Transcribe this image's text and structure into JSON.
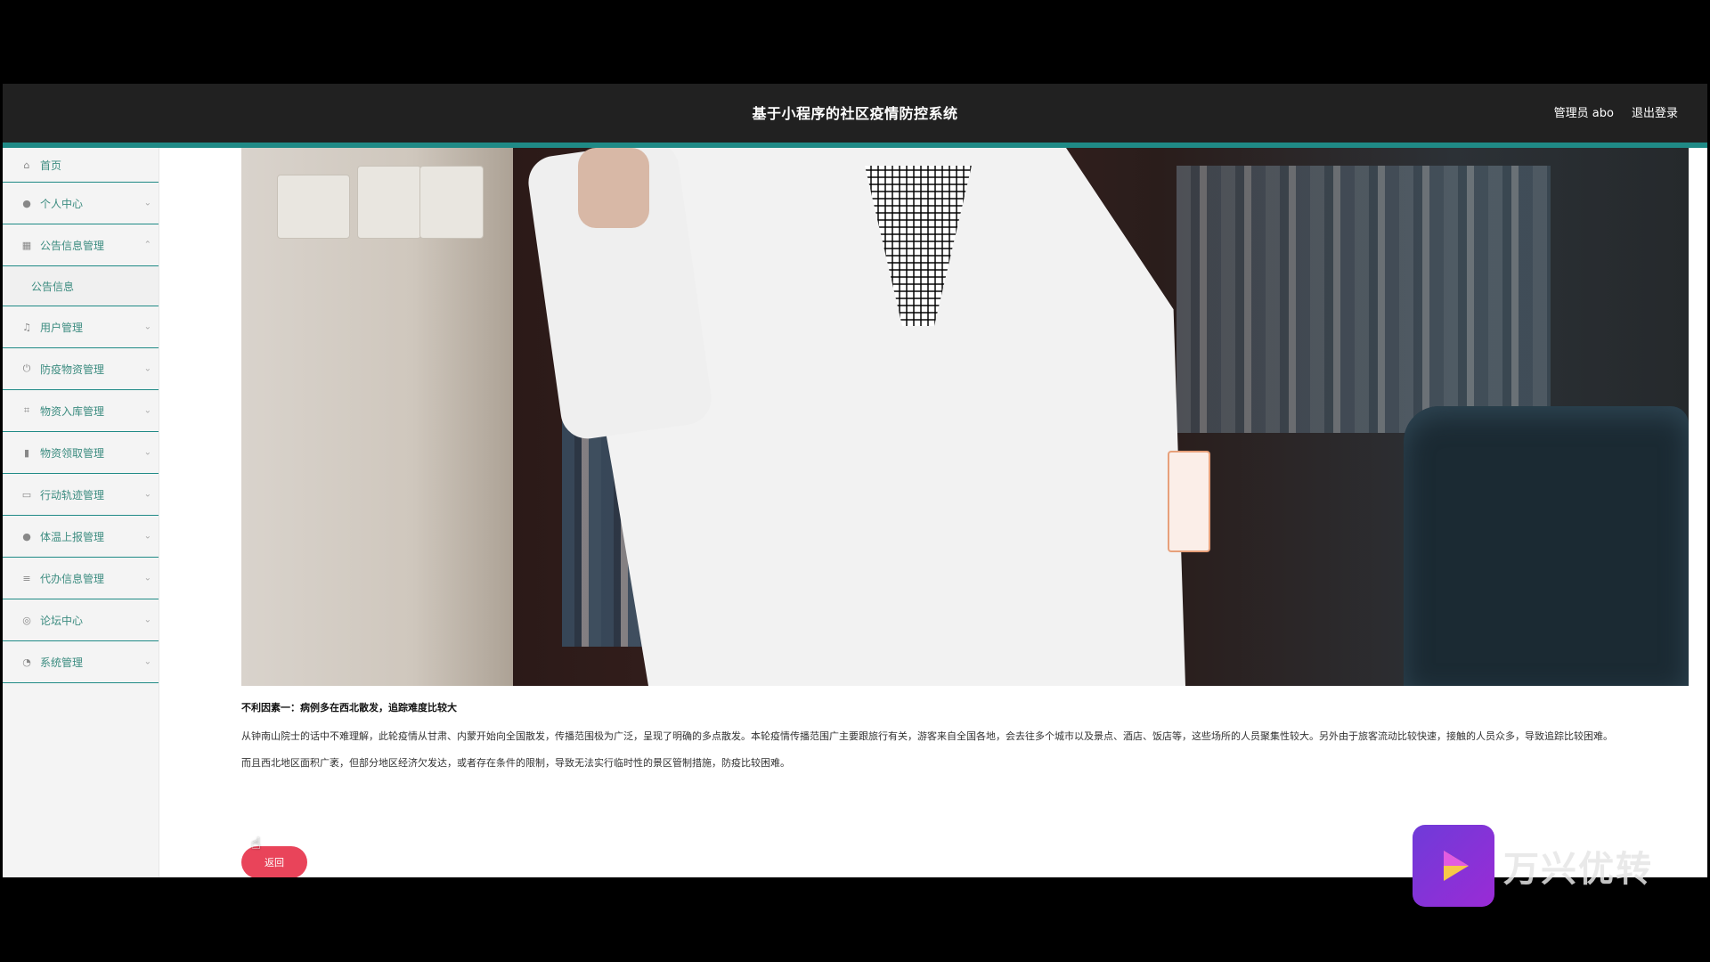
{
  "header": {
    "title": "基于小程序的社区疫情防控系统",
    "user_label": "管理员 abo",
    "logout_label": "退出登录"
  },
  "sidebar": {
    "items": [
      {
        "label": "首页",
        "icon": "home-icon"
      },
      {
        "label": "个人中心",
        "icon": "user-icon"
      },
      {
        "label": "公告信息管理",
        "icon": "notice-icon"
      },
      {
        "label": "用户管理",
        "icon": "mic-icon"
      },
      {
        "label": "防疫物资管理",
        "icon": "power-icon"
      },
      {
        "label": "物资入库管理",
        "icon": "crop-icon"
      },
      {
        "label": "物资领取管理",
        "icon": "bar-chart-icon"
      },
      {
        "label": "行动轨迹管理",
        "icon": "message-icon"
      },
      {
        "label": "体温上报管理",
        "icon": "user-icon"
      },
      {
        "label": "代办信息管理",
        "icon": "list-icon"
      },
      {
        "label": "论坛中心",
        "icon": "compass-icon"
      },
      {
        "label": "系统管理",
        "icon": "clock-icon"
      }
    ],
    "submenu_label": "公告信息"
  },
  "article": {
    "heading": "不利因素一：病例多在西北散发，追踪难度比较大",
    "paragraph1": "从钟南山院士的话中不难理解，此轮疫情从甘肃、内蒙开始向全国散发，传播范围极为广泛，呈现了明确的多点散发。本轮疫情传播范围广主要跟旅行有关，游客来自全国各地，会去往多个城市以及景点、酒店、饭店等，这些场所的人员聚集性较大。另外由于旅客流动比较快速，接触的人员众多，导致追踪比较困难。",
    "paragraph2": "而且西北地区面积广袤，但部分地区经济欠发达，或者存在条件的限制，导致无法实行临时性的景区管制措施，防疫比较困难。",
    "back_label": "返回"
  },
  "watermark": {
    "text": "万兴优转"
  },
  "colors": {
    "accent": "#1f8a86",
    "header_bg": "#212121",
    "button": "#e9445a"
  }
}
